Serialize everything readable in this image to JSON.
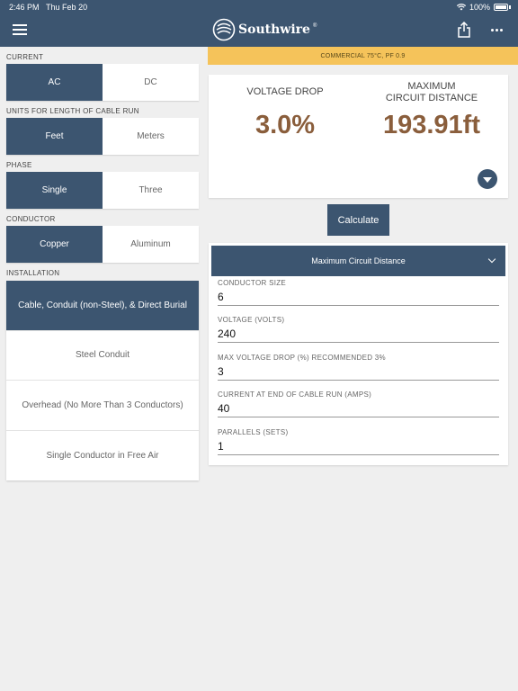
{
  "status": {
    "time": "2:46 PM",
    "date": "Thu Feb 20",
    "battery": "100%"
  },
  "app": {
    "logo_text": "Southwire",
    "registered": "®"
  },
  "left": {
    "current": {
      "label": "CURRENT",
      "options": [
        "AC",
        "DC"
      ],
      "selected": "AC"
    },
    "units": {
      "label": "UNITS FOR LENGTH OF CABLE RUN",
      "options": [
        "Feet",
        "Meters"
      ],
      "selected": "Feet"
    },
    "phase": {
      "label": "PHASE",
      "options": [
        "Single",
        "Three"
      ],
      "selected": "Single"
    },
    "conductor": {
      "label": "CONDUCTOR",
      "options": [
        "Copper",
        "Aluminum"
      ],
      "selected": "Copper"
    },
    "installation": {
      "label": "INSTALLATION",
      "options": [
        "Cable, Conduit (non-Steel), & Direct Burial",
        "Steel Conduit",
        "Overhead (No More Than 3 Conductors)",
        "Single Conductor in Free Air"
      ],
      "selected": "Cable, Conduit (non-Steel), & Direct Burial"
    }
  },
  "banner": "COMMERCIAL 75°C, PF 0.9",
  "results": {
    "voltage_drop_label": "VOLTAGE DROP",
    "voltage_drop_value": "3.0%",
    "max_distance_label_1": "MAXIMUM",
    "max_distance_label_2": "CIRCUIT DISTANCE",
    "max_distance_value": "193.91ft"
  },
  "calculate_label": "Calculate",
  "form": {
    "mode": "Maximum Circuit Distance",
    "fields": [
      {
        "label": "CONDUCTOR SIZE",
        "value": "6"
      },
      {
        "label": "VOLTAGE (VOLTS)",
        "value": "240"
      },
      {
        "label": "MAX VOLTAGE DROP (%) RECOMMENDED 3%",
        "value": "3"
      },
      {
        "label": "CURRENT AT END OF CABLE RUN (AMPS)",
        "value": "40"
      },
      {
        "label": "PARALLELS (SETS)",
        "value": "1"
      }
    ]
  },
  "colors": {
    "primary": "#3c5570",
    "accent": "#8a5e3c",
    "banner": "#f5c35a"
  }
}
